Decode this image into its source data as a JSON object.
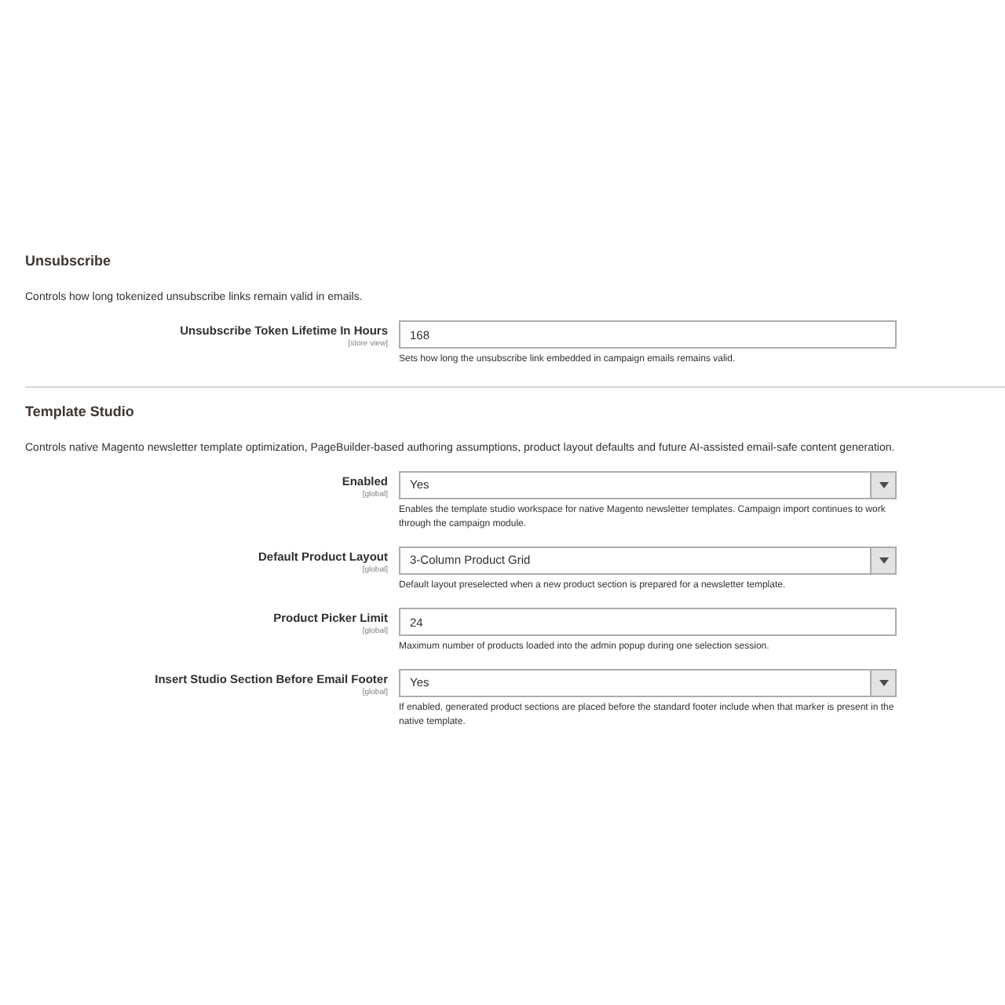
{
  "sections": [
    {
      "title": "Unsubscribe",
      "description": "Controls how long tokenized unsubscribe links remain valid in emails.",
      "fields": [
        {
          "kind": "text",
          "label": "Unsubscribe Token Lifetime In Hours",
          "scope": "[store view]",
          "value": "168",
          "note": "Sets how long the unsubscribe link embedded in campaign emails remains valid."
        }
      ]
    },
    {
      "title": "Template Studio",
      "description": "Controls native Magento newsletter template optimization, PageBuilder-based authoring assumptions, product layout defaults and future AI-assisted email-safe content generation.",
      "fields": [
        {
          "kind": "select",
          "label": "Enabled",
          "scope": "[global]",
          "value": "Yes",
          "note": "Enables the template studio workspace for native Magento newsletter templates. Campaign import continues to work through the campaign module."
        },
        {
          "kind": "select",
          "label": "Default Product Layout",
          "scope": "[global]",
          "value": "3-Column Product Grid",
          "note": "Default layout preselected when a new product section is prepared for a newsletter template."
        },
        {
          "kind": "text",
          "label": "Product Picker Limit",
          "scope": "[global]",
          "value": "24",
          "note": "Maximum number of products loaded into the admin popup during one selection session."
        },
        {
          "kind": "select",
          "label": "Insert Studio Section Before Email Footer",
          "scope": "[global]",
          "value": "Yes",
          "note": "If enabled, generated product sections are placed before the standard footer include when that marker is present in the native template."
        }
      ]
    }
  ]
}
